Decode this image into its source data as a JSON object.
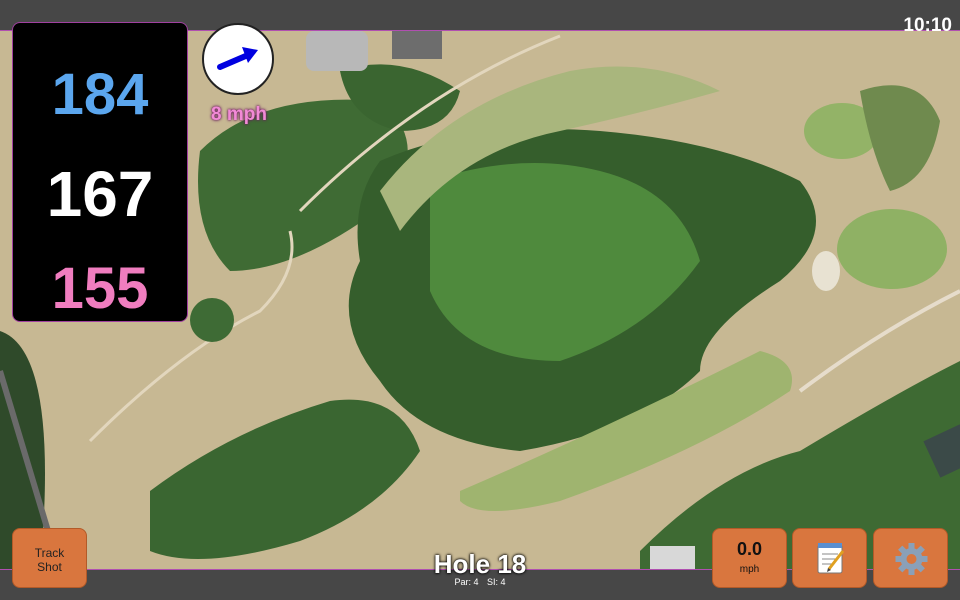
{
  "status_bar": {
    "time": "10:10"
  },
  "yardage": {
    "back": "184",
    "middle": "167",
    "front": "155"
  },
  "wind": {
    "speed_label": "8 mph",
    "direction_icon": "wind-arrow-icon"
  },
  "buttons": {
    "track_shot_line1": "Track",
    "track_shot_line2": "Shot",
    "wind_value": "0.0",
    "wind_unit": "mph",
    "notes_icon": "notepad-icon",
    "settings_icon": "gear-icon"
  },
  "hole": {
    "title": "Hole 18",
    "par": "Par: 4",
    "si": "SI: 4"
  },
  "colors": {
    "back": "#5ba6ee",
    "middle": "#ffffff",
    "front": "#f07dbf",
    "button": "#d9763e",
    "wind_text": "#f28ad6"
  }
}
